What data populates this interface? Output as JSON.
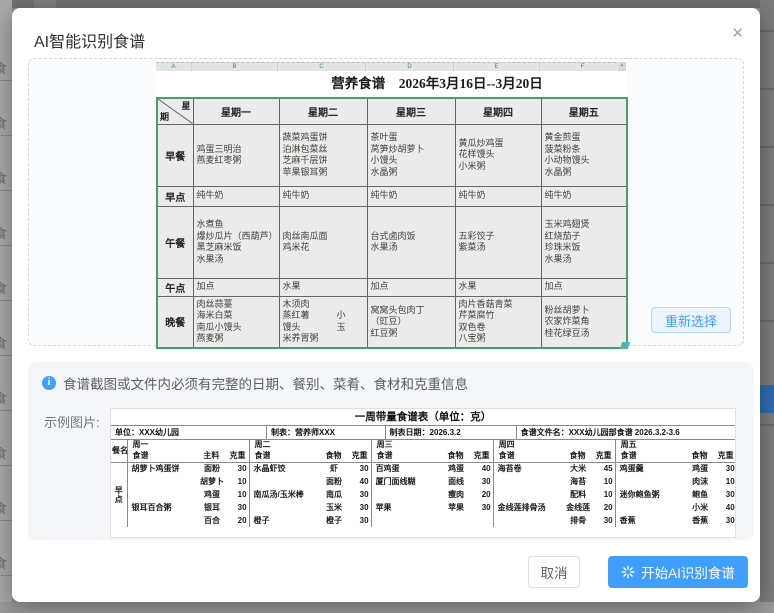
{
  "dialog": {
    "title": "AI智能识别食谱",
    "close_glyph": "✕"
  },
  "backdrop": {
    "glyph": "食"
  },
  "preview": {
    "sheet_columns": [
      "A",
      "B",
      "C",
      "D",
      "E",
      "F"
    ],
    "title": "营养食谱　2026年3月16日--3月20日",
    "corner": {
      "top": "星",
      "bottom": "期"
    },
    "days": [
      "星期一",
      "星期二",
      "星期三",
      "星期四",
      "星期五"
    ],
    "rows": [
      {
        "label": "早餐",
        "cells": [
          [
            "鸡蛋三明治",
            "燕麦红枣粥"
          ],
          [
            "蔬菜鸡蛋饼",
            "泊淋包菜丝",
            "芝麻千层饼",
            "苹果银耳粥"
          ],
          [
            "茶叶蛋",
            "莴笋炒胡萝卜",
            "小馒头",
            "水晶粥"
          ],
          [
            "黄瓜炒鸡蛋",
            "花样馒头",
            "小米粥"
          ],
          [
            "黄金煎蛋",
            "菠菜粉条",
            "小动物馒头",
            "水晶粥"
          ]
        ]
      },
      {
        "label": "早点",
        "cells": [
          [
            "纯牛奶"
          ],
          [
            "纯牛奶"
          ],
          [
            "纯牛奶"
          ],
          [
            "纯牛奶"
          ],
          [
            "纯牛奶"
          ]
        ]
      },
      {
        "label": "午餐",
        "cells": [
          [
            "水煮鱼",
            "爆炒瓜片（西葫芦）",
            "黑芝麻米饭",
            "水果汤"
          ],
          [
            "肉丝南瓜面",
            "鸡米花"
          ],
          [
            "台式卤肉饭",
            "水果汤"
          ],
          [
            "五彩饺子",
            "紫菜汤"
          ],
          [
            "玉米鸡翅煲",
            "红烧茄子",
            "珍珠米饭",
            "水果汤"
          ]
        ]
      },
      {
        "label": "午点",
        "cells": [
          [
            "加点"
          ],
          [
            "水果"
          ],
          [
            "加点"
          ],
          [
            "水果"
          ],
          [
            "加点"
          ]
        ]
      },
      {
        "label": "晚餐",
        "cells": [
          [
            "肉丝蒜薹",
            "海米白菜",
            "南瓜小馒头",
            "燕麦粥"
          ],
          [
            "木须肉",
            "蒸红薯　　　小",
            "馒头　　　　玉",
            "米养胃粥"
          ],
          [
            "窝窝头包肉丁",
            "（豇豆）",
            "红豆粥"
          ],
          [
            "肉片香菇青菜",
            "芹菜腐竹",
            "双色卷",
            "八宝粥"
          ],
          [
            "粉丝胡萝卜",
            "农家炸菜角",
            "桂花绿豆汤"
          ]
        ]
      }
    ],
    "reselect_label": "重新选择"
  },
  "notice": {
    "text": "食谱截图或文件内必须有完整的日期、餐别、菜肴、食材和克重信息"
  },
  "example": {
    "label": "示例图片:",
    "title": "一周带量食谱表（单位：克）",
    "meta": [
      "单位：XXX幼儿园",
      "制表：营养师XXX",
      "制表日期：2026.3.2",
      "食谱文件名：XXX幼儿园部食谱 2026.3.2-3.6"
    ],
    "meal_col": "餐名",
    "meal_label": "早点",
    "groups": [
      {
        "day": "周一",
        "cols": [
          "食谱",
          "主料",
          "克重"
        ],
        "rows": [
          [
            "胡萝卜鸡蛋饼",
            "面粉",
            "30"
          ],
          [
            "",
            "胡萝卜",
            "10"
          ],
          [
            "",
            "鸡蛋",
            "10"
          ],
          [
            "银耳百合粥",
            "银耳",
            "30"
          ],
          [
            "",
            "百合",
            "20"
          ]
        ]
      },
      {
        "day": "周二",
        "cols": [
          "食谱",
          "食物",
          "克重"
        ],
        "rows": [
          [
            "水晶虾饺",
            "虾",
            "30"
          ],
          [
            "",
            "面粉",
            "40"
          ],
          [
            "南瓜汤/玉米棒",
            "南瓜",
            "30"
          ],
          [
            "",
            "玉米",
            "30"
          ],
          [
            "橙子",
            "橙子",
            "30"
          ]
        ]
      },
      {
        "day": "周三",
        "cols": [
          "食谱",
          "食物",
          "克重"
        ],
        "rows": [
          [
            "百鸡蛋",
            "鸡蛋",
            "40"
          ],
          [
            "厦门面线糊",
            "面线",
            "30"
          ],
          [
            "",
            "瘦肉",
            "20"
          ],
          [
            "苹果",
            "苹果",
            "30"
          ],
          [
            "",
            "",
            ""
          ]
        ]
      },
      {
        "day": "周四",
        "cols": [
          "食谱",
          "食物",
          "克重"
        ],
        "rows": [
          [
            "海苔卷",
            "大米",
            "45"
          ],
          [
            "",
            "海苔",
            "10"
          ],
          [
            "",
            "配料",
            "10"
          ],
          [
            "金线莲排骨汤",
            "金线莲",
            "20"
          ],
          [
            "",
            "排骨",
            "30"
          ]
        ]
      },
      {
        "day": "周五",
        "cols": [
          "食谱",
          "食物",
          "克重"
        ],
        "rows": [
          [
            "鸡蛋羹",
            "鸡蛋",
            "30"
          ],
          [
            "",
            "肉沫",
            "10"
          ],
          [
            "迷你鲍鱼粥",
            "鲍鱼",
            "30"
          ],
          [
            "",
            "小米",
            "40"
          ],
          [
            "香蕉",
            "香蕉",
            "30"
          ]
        ]
      }
    ]
  },
  "footer": {
    "cancel": "取消",
    "submit": "开始AI识别食谱"
  },
  "colors": {
    "primary": "#409eff",
    "primary_plain_bg": "#ecf5ff",
    "notice_bg": "#f4f6f9",
    "sheet_border_green": "#44a06c"
  }
}
